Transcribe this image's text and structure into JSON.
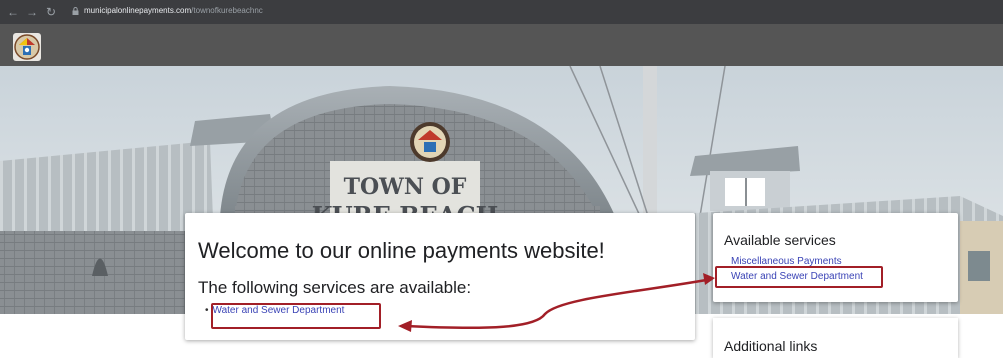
{
  "browser": {
    "url_domain": "municipalonlinepayments.com",
    "url_path": "/townofkurebeachnc"
  },
  "hero": {
    "sign_line1": "TOWN OF",
    "sign_line2": "KURE BEACH"
  },
  "welcome": {
    "title": "Welcome to our online payments website!",
    "subtitle": "The following services are available:",
    "services": [
      "Water and Sewer Department"
    ]
  },
  "sidebar": {
    "available_title": "Available services",
    "available_links": [
      "Miscellaneous Payments",
      "Water and Sewer Department"
    ],
    "additional_title": "Additional links"
  },
  "colors": {
    "annotation": "#a21f27",
    "link": "#3b44b6",
    "header": "#555555"
  }
}
